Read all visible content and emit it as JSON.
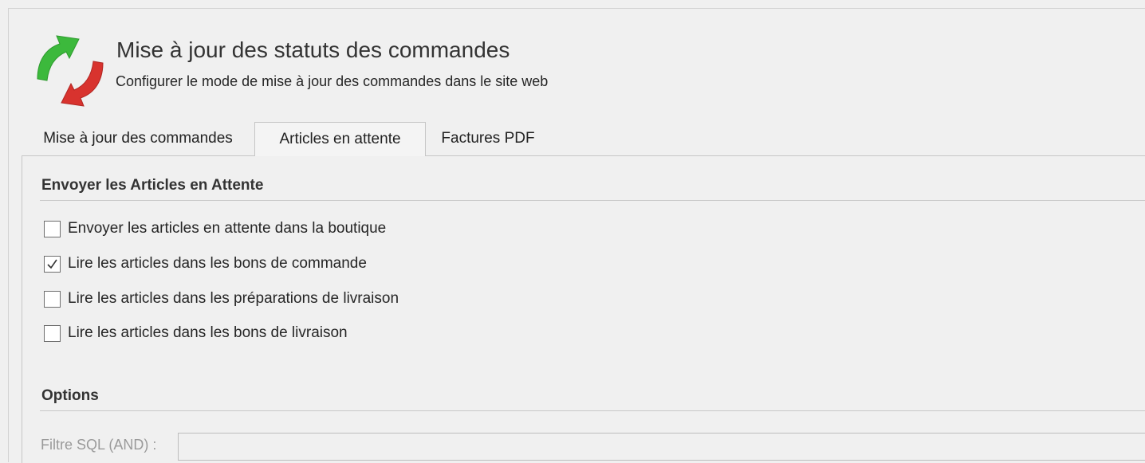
{
  "header": {
    "title": "Mise à jour des statuts des commandes",
    "subtitle": "Configurer le mode de mise à jour des commandes dans le site web",
    "logo_icon": "sync-arrows-icon",
    "colors": {
      "green_arrow": "#3cb93c",
      "red_arrow": "#d8332e"
    }
  },
  "tabs": [
    {
      "label": "Mise à jour des commandes",
      "active": false
    },
    {
      "label": "Articles en attente",
      "active": true
    },
    {
      "label": "Factures PDF",
      "active": false
    }
  ],
  "pending": {
    "section_title": "Envoyer les Articles en Attente",
    "options": [
      {
        "label": "Envoyer les articles en attente dans la boutique",
        "checked": false
      },
      {
        "label": "Lire les articles dans les bons de commande",
        "checked": true
      },
      {
        "label": "Lire les articles dans les préparations de livraison",
        "checked": false
      },
      {
        "label": "Lire les articles dans les bons de livraison",
        "checked": false
      }
    ]
  },
  "options": {
    "section_title": "Options",
    "sql_filter": {
      "label": "Filtre SQL (AND) :",
      "value": ""
    }
  }
}
